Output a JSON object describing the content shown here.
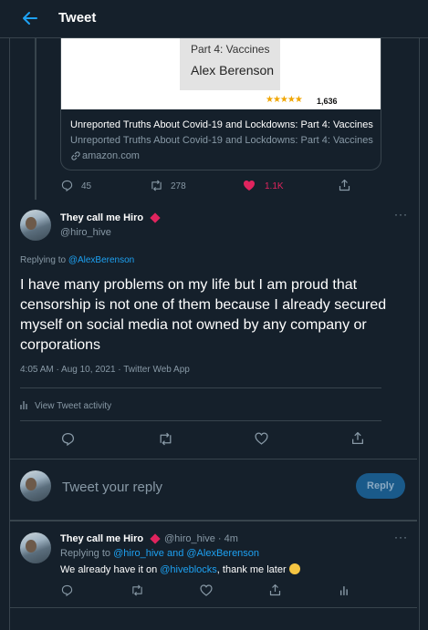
{
  "header": {
    "title": "Tweet"
  },
  "quoted_tweet": {
    "book_line1": "Part 4: Vaccines",
    "book_line2": "Alex Berenson",
    "rating_count": "1,636",
    "card_title": "Unreported Truths About Covid-19 and Lockdowns: Part 4: Vaccines",
    "card_desc": "Unreported Truths About Covid-19 and Lockdowns: Part 4: Vaccines",
    "card_domain": "amazon.com",
    "replies": "45",
    "retweets": "278",
    "likes": "1.1K"
  },
  "main_tweet": {
    "display_name": "They call me Hiro",
    "handle": "@hiro_hive",
    "replying_prefix": "Replying to",
    "replying_to": "@AlexBerenson",
    "text": "I have many problems on my life but I am proud that censorship is not one of them because I already secured myself on social media not owned by any company or corporations",
    "meta": "4:05 AM · Aug 10, 2021 · Twitter Web App",
    "activity": "View Tweet activity"
  },
  "composer": {
    "placeholder": "Tweet your reply",
    "reply_label": "Reply"
  },
  "reply_tweet": {
    "display_name": "They call me Hiro",
    "handle_time": "@hiro_hive · 4m",
    "replying_prefix": "Replying to",
    "replying_to": "@hiro_hive and @AlexBerenson",
    "text_before": "We already have it on",
    "mention": "@hiveblocks",
    "text_after": ", thank me later"
  },
  "colors": {
    "background": "#15202b",
    "accent": "#1da1f2",
    "like": "#e0245e",
    "border": "#38444d",
    "muted": "#8899a6"
  }
}
